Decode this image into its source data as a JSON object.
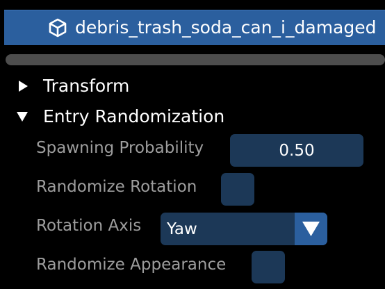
{
  "entity": {
    "name": "debris_trash_soda_can_i_damaged",
    "icon": "cube-icon"
  },
  "tree": {
    "transform": {
      "label": "Transform",
      "expanded": false
    },
    "entry_randomization": {
      "label": "Entry Randomization",
      "expanded": true
    }
  },
  "properties": {
    "spawning_probability": {
      "label": "Spawning Probability",
      "value": "0.50"
    },
    "randomize_rotation": {
      "label": "Randomize Rotation",
      "checked": false
    },
    "rotation_axis": {
      "label": "Rotation Axis",
      "value": "Yaw"
    },
    "randomize_appearance": {
      "label": "Randomize Appearance",
      "checked": false
    }
  },
  "colors": {
    "background": "#000000",
    "selection": "#2b5f9e",
    "frame": "#1c3857",
    "label_dim": "#9d9d9d",
    "scrollbar": "#4d4d4d"
  }
}
